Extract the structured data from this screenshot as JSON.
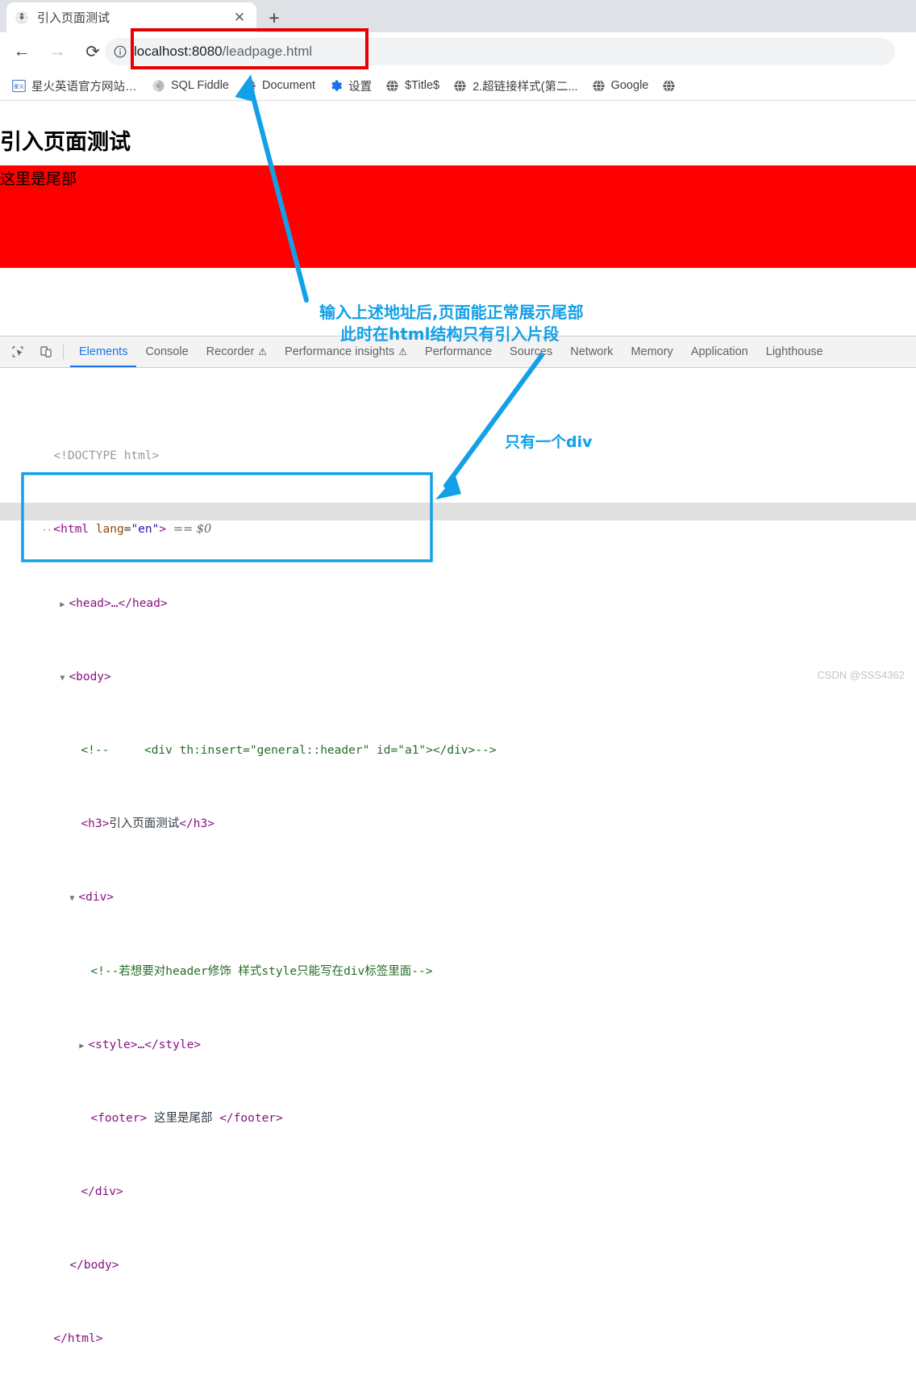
{
  "browser": {
    "tab": {
      "title": "引入页面测试",
      "favicon": "globe-icon",
      "close_label": "✕"
    },
    "new_tab_label": "+",
    "nav": {
      "back_label": "←",
      "forward_label": "→",
      "reload_label": "⟳"
    },
    "omnibox": {
      "info_icon": "info-circle-icon",
      "url_host": "localhost:8080",
      "url_path": "/leadpage.html",
      "highlight_color": "#e60000"
    },
    "bookmarks": [
      {
        "label": "星火英语官方网站-...",
        "icon": "xinghuo-icon"
      },
      {
        "label": "SQL Fiddle",
        "icon": "sql-fiddle-icon"
      },
      {
        "label": "Document",
        "icon": "globe-icon"
      },
      {
        "label": "设置",
        "icon": "gear-icon"
      },
      {
        "label": "$Title$",
        "icon": "globe-icon"
      },
      {
        "label": "2.超链接样式(第二...",
        "icon": "globe-icon"
      },
      {
        "label": "Google",
        "icon": "globe-icon"
      },
      {
        "label": "",
        "icon": "globe-icon"
      }
    ]
  },
  "page": {
    "heading": "引入页面测试",
    "footer_text": "这里是尾部",
    "footer_color": "#ff0000"
  },
  "devtools": {
    "icons": {
      "inspect": "inspect-cursor-icon",
      "device": "device-toolbar-icon"
    },
    "tabs": [
      {
        "label": "Elements",
        "active": true,
        "warning": false
      },
      {
        "label": "Console",
        "active": false,
        "warning": false
      },
      {
        "label": "Recorder",
        "active": false,
        "warning": true
      },
      {
        "label": "Performance insights",
        "active": false,
        "warning": true
      },
      {
        "label": "Performance",
        "active": false,
        "warning": false
      },
      {
        "label": "Sources",
        "active": false,
        "warning": false
      },
      {
        "label": "Network",
        "active": false,
        "warning": false
      },
      {
        "label": "Memory",
        "active": false,
        "warning": false
      },
      {
        "label": "Application",
        "active": false,
        "warning": false
      },
      {
        "label": "Lighthouse",
        "active": false,
        "warning": false
      }
    ],
    "warning_glyph": "⚠",
    "dom": {
      "doctype": "<!DOCTYPE html>",
      "html_open_tag": "<html",
      "html_attr_name": "lang",
      "html_attr_value": "\"en\"",
      "html_close_bracket": ">",
      "selected_marker": "== $0",
      "head_line": "<head>…</head>",
      "body_open": "<body>",
      "comment_header": "<!--     <div th:insert=\"general::header\" id=\"a1\"></div>-->",
      "h3_open": "<h3>",
      "h3_text": "引入页面测试",
      "h3_close": "</h3>",
      "div_open": "<div>",
      "comment_style": "<!--若想要对header修饰 样式style只能写在div标签里面-->",
      "style_line": "<style>…</style>",
      "footer_open": "<footer>",
      "footer_text": " 这里是尾部 ",
      "footer_close": "</footer>",
      "div_close": "</div>",
      "body_close": "</body>",
      "html_close": "</html>"
    },
    "highlight_box_color": "#12a0e8"
  },
  "annotations": {
    "note_1_line_1": "输入上述地址后,页面能正常展示尾部",
    "note_1_line_2": "此时在html结构只有引入片段",
    "note_2": "只有一个div",
    "color": "#12a0e8"
  },
  "watermark": "CSDN @SSS4362"
}
